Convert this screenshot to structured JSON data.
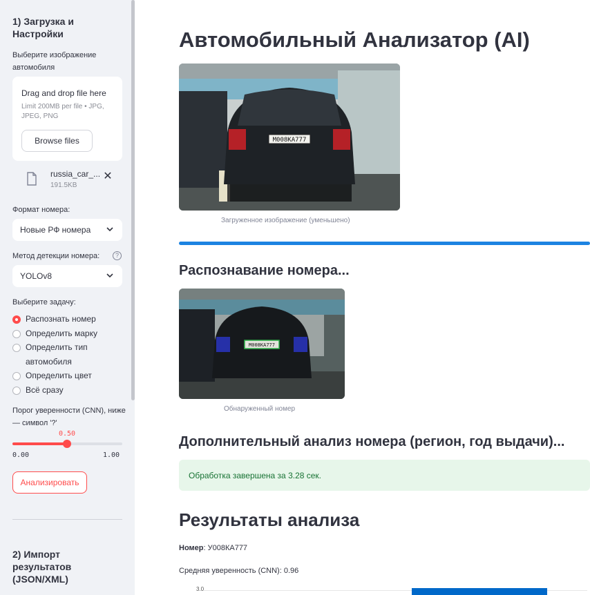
{
  "sidebar": {
    "section1_title": "1) Загрузка и Настройки",
    "upload_label": "Выберите изображение автомобиля",
    "dropzone_title": "Drag and drop file here",
    "dropzone_limit": "Limit 200MB per file • JPG, JPEG, PNG",
    "browse_label": "Browse files",
    "file_name": "russia_car_...",
    "file_size": "191.5KB",
    "plate_format_label": "Формат номера:",
    "plate_format_value": "Новые РФ номера",
    "detect_method_label": "Метод детекции номера:",
    "detect_method_value": "YOLOv8",
    "task_label": "Выберите задачу:",
    "tasks": [
      {
        "label": "Распознать номер",
        "selected": true
      },
      {
        "label": "Определить марку",
        "selected": false
      },
      {
        "label": "Определить тип",
        "selected": false
      },
      {
        "label": "автомобиля",
        "selected": false
      },
      {
        "label": "Определить цвет",
        "selected": false
      },
      {
        "label": "Всё сразу",
        "selected": false
      }
    ],
    "threshold_label_1": "Порог уверенности (CNN), ниже",
    "threshold_label_2": "— символ '?'",
    "threshold_value": "0.50",
    "threshold_fraction": 0.5,
    "threshold_min": "0.00",
    "threshold_max": "1.00",
    "analyze_label": "Анализировать",
    "section2_title_1": "2) Импорт",
    "section2_title_2": "результатов",
    "section2_title_3": "(JSON/XML)"
  },
  "main": {
    "title": "Автомобильный Анализатор (AI)",
    "image1_plate_text": "М008КА777",
    "image1_caption": "Загруженное изображение (уменьшено)",
    "progress": 1.0,
    "recog_heading": "Распознавание номера...",
    "image2_plate_text": "М008КА777",
    "image2_caption": "Обнаруженный номер",
    "extra_heading": "Дополнительный анализ номера (регион, год выдачи)...",
    "success_text": "Обработка завершена за 3.28 сек.",
    "results_heading": "Результаты анализа",
    "plate_label": "Номер",
    "plate_value": ": У008КА777",
    "confidence_text": "Средняя уверенность (CNN): 0.96",
    "chart_tick": "3.0"
  },
  "colors": {
    "accent": "#ff4b4b",
    "progress": "#1c83e1",
    "success_bg": "#e7f6ea",
    "success_text": "#177233",
    "bar": "#0068c9"
  }
}
